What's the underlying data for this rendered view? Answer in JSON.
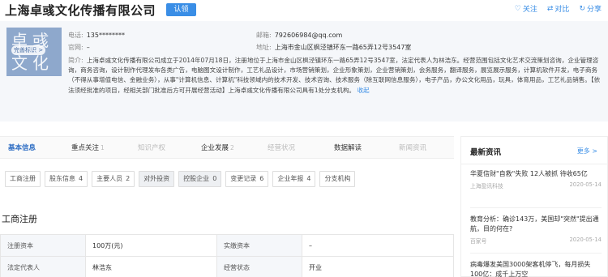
{
  "header": {
    "company_name": "上海卓彧文化传播有限公司",
    "claim_label": "认领",
    "actions": [
      {
        "icon": "heart-icon",
        "glyph": "♡",
        "label": "关注"
      },
      {
        "icon": "compare-icon",
        "glyph": "⇄",
        "label": "对比"
      },
      {
        "icon": "share-icon",
        "glyph": "↻",
        "label": "分享"
      }
    ]
  },
  "logo": {
    "text": "卓彧文化",
    "badge": "完善标识 >"
  },
  "info": {
    "phone_label": "电话:",
    "phone": "135********",
    "website_label": "官网:",
    "website": "–",
    "email_label": "邮箱:",
    "email": "792606984@qq.com",
    "address_label": "地址:",
    "address": "上海市金山区枫泾镇环东一路65弄12号3547室",
    "intro_label": "简介:",
    "intro": "上海卓彧文化传播有限公司成立于2014年07月18日，注册地位于上海市金山区枫泾镇环东一路65弄12号3547室，法定代表人为林浩东。经营范围包括文化艺术交流策划咨询，企业管理咨询，商务咨询，设计制作代理发布各类广告，电脑图文设计制作，工艺礼品设计，市场营销策划，企业形象策划，企业营销策划，会务服务，翻译服务，展览展示服务，计算机软件开发，电子商务（不得从事增值电信、金融业务），从事\"计算机信息、计算机\"科技领域内的技术开发、技术咨询、技术服务（除互联网信息服务），电子产品，办公文化用品，玩具，体育用品，工艺礼品销售。【依法须经批准的项目，经相关部门批准后方可开展经营活动】上海卓彧文化传播有限公司具有1处分支机构。",
    "collapse": "收起"
  },
  "tabs": [
    {
      "label": "基本信息",
      "count": "",
      "state": "active"
    },
    {
      "label": "重点关注",
      "count": "1",
      "state": "normal"
    },
    {
      "label": "知识产权",
      "count": "",
      "state": "disabled"
    },
    {
      "label": "企业发展",
      "count": "2",
      "state": "normal"
    },
    {
      "label": "经营状况",
      "count": "",
      "state": "disabled"
    },
    {
      "label": "数据解读",
      "count": "",
      "state": "normal"
    },
    {
      "label": "新闻资讯",
      "count": "",
      "state": "disabled"
    }
  ],
  "subtabs": [
    {
      "label": "工商注册",
      "count": ""
    },
    {
      "label": "股东信息",
      "count": "4"
    },
    {
      "label": "主要人员",
      "count": "2"
    },
    {
      "label": "对外投资",
      "count": ""
    },
    {
      "label": "控股企业",
      "count": "0"
    },
    {
      "label": "变更记录",
      "count": "6"
    },
    {
      "label": "企业年报",
      "count": "4"
    },
    {
      "label": "分支机构",
      "count": ""
    }
  ],
  "registration": {
    "title": "工商注册",
    "rows": [
      [
        "注册资本",
        "100万(元)",
        "实缴资本",
        "–"
      ],
      [
        "法定代表人",
        "林浩东",
        "经营状态",
        "开业"
      ]
    ]
  },
  "news": {
    "title": "最新资讯",
    "more": "更多 >",
    "items": [
      {
        "title": "华夏信财\"自救\"失败 12人被抓 待收65亿",
        "source": "上海盈讯科技",
        "date": "2020-05-14"
      },
      {
        "title": "教育分析：确诊143万，美国却\"突然\"提出通航，目的何在?",
        "source": "百家号",
        "date": "2020-05-14"
      },
      {
        "title": "病毒爆发美国3000架客机停飞，每月损失100亿：成千上万空",
        "source": "",
        "date": ""
      }
    ]
  }
}
